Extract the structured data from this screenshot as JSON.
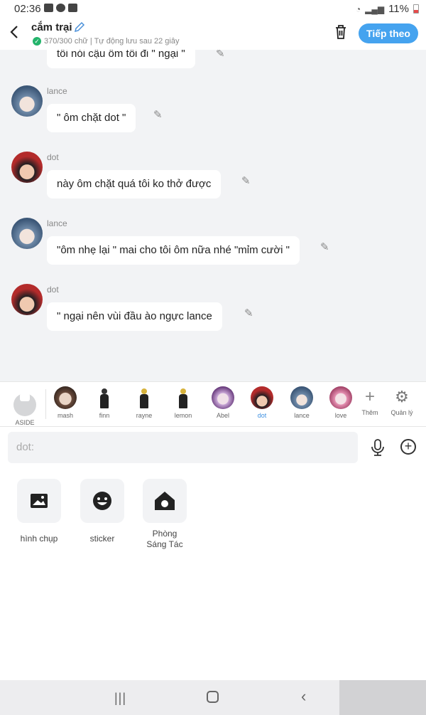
{
  "status": {
    "time": "02:36",
    "battery": "11%"
  },
  "header": {
    "title": "cắm trại",
    "subinfo": "370/300 chữ | Tự động lưu sau 22 giây",
    "next_label": "Tiếp theo"
  },
  "messages": [
    {
      "sender": "",
      "text": "tôi nói cậu ôm tôi đi \" ngại \""
    },
    {
      "sender": "lance",
      "text": "\" ôm chặt dot \""
    },
    {
      "sender": "dot",
      "text": "này ôm chặt quá tôi ko thở được"
    },
    {
      "sender": "lance",
      "text": "\"ôm nhẹ lại \" mai cho tôi ôm nữa nhé \"mỉm cười \""
    },
    {
      "sender": "dot",
      "text": "\" ngại  nên vùi đầu ào ngực lance"
    }
  ],
  "characters": [
    "ASIDE",
    "mash",
    "finn",
    "rayne",
    "lemon",
    "Abel",
    "dot",
    "lance",
    "love",
    "Thêm",
    "Quản lý"
  ],
  "selected_character": "dot",
  "input": {
    "placeholder": "dot:"
  },
  "tools": {
    "photo": "hình chụp",
    "sticker": "sticker",
    "room_line1": "Phòng",
    "room_line2": "Sáng Tác"
  }
}
